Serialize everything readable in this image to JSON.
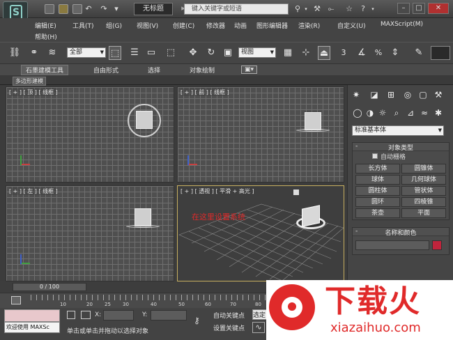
{
  "title_bar": {
    "document_title": "无标题",
    "search_placeholder": "键入关键字或短语",
    "logo_letter": "S"
  },
  "menu": {
    "row1": [
      "编辑(E)",
      "工具(T)",
      "组(G)",
      "视图(V)",
      "创建(C)",
      "修改器",
      "动画",
      "图形编辑器",
      "渲染(R)",
      "自定义(U)",
      "MAXScript(M)"
    ],
    "row2": [
      "帮助(H)"
    ]
  },
  "toolbar": {
    "selection_filter": "全部",
    "reference_coord": "视图",
    "num_labels": [
      "3",
      "%"
    ]
  },
  "ribbon": {
    "tabs": [
      "石墨建模工具",
      "自由形式",
      "选择",
      "对象绘制"
    ],
    "active_tab": "石墨建模工具",
    "sub_panel": "多边形建模"
  },
  "viewports": {
    "top": "[ + ] [ 顶 ] [ 线框 ]",
    "front": "[ + ] [ 前 ] [ 线框 ]",
    "left": "[ + ] [ 左 ] [ 线框 ]",
    "perspective": "[ + ] [ 透视 ] [ 平滑 + 高光 ]",
    "overlay_text": "在这里设置系统"
  },
  "command_panel": {
    "category": "标准基本体",
    "object_type_title": "对象类型",
    "autogrid_label": "自动栅格",
    "objects": [
      "长方体",
      "圆锥体",
      "球体",
      "几何球体",
      "圆柱体",
      "管状体",
      "圆环",
      "四棱锥",
      "茶壶",
      "平面"
    ],
    "name_color_title": "名称和颜色",
    "object_color": "#c0243c"
  },
  "timeline": {
    "slider_label": "0 / 100",
    "ruler_ticks": [
      "10",
      "20",
      "25",
      "30",
      "40",
      "50",
      "60",
      "70",
      "80"
    ]
  },
  "status": {
    "welcome": "欢迎使用 MAXSc",
    "x_label": "X:",
    "y_label": "Y:",
    "prompt": "单击或单击并拖动以选择对象",
    "auto_key": "自动关键点",
    "set_key": "设置关键点",
    "selected": "选定"
  },
  "watermark": {
    "brand": "下载火",
    "url": "xiazaihuo.com"
  },
  "colors": {
    "accent_red": "#e02a2a",
    "viewport_bg": "#4f4f4f"
  }
}
